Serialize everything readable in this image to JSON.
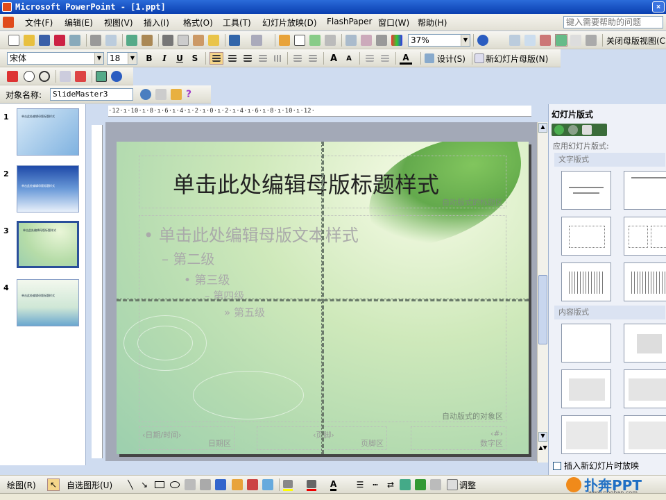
{
  "window": {
    "title": "Microsoft PowerPoint - [1.ppt]",
    "min": "_",
    "max": "□",
    "close": "×"
  },
  "menu": {
    "items": [
      "文件(F)",
      "编辑(E)",
      "视图(V)",
      "插入(I)",
      "格式(O)",
      "工具(T)",
      "幻灯片放映(D)",
      "FlashPaper",
      "窗口(W)",
      "帮助(H)"
    ],
    "help_placeholder": "键入需要帮助的问题"
  },
  "standard_toolbar": {
    "zoom": "37%",
    "close_master_view": "关闭母版视图(C)"
  },
  "formatting_toolbar": {
    "font": "宋体",
    "size": "18",
    "bold": "B",
    "italic": "I",
    "underline": "U",
    "shadow": "S",
    "font_color": "A",
    "design": "设计(S)",
    "new_master": "新幻灯片母版(N)"
  },
  "object_toolbar": {
    "label": "对象名称:",
    "object_name": "SlideMaster3"
  },
  "slides": {
    "numbers": [
      "1",
      "2",
      "3",
      "4"
    ],
    "thumb_title": "单击此处编辑母版标题样式"
  },
  "ruler": {
    "h": "·12·ı·10·ı·8·ı·6·ı·4·ı·2·ı·0·ı·2·ı·4·ı·6·ı·8·ı·10·ı·12·"
  },
  "slide": {
    "title": "单击此处编辑母版标题样式",
    "title_area": "自动版式的标题区",
    "bullets": [
      "单击此处编辑母版文本样式",
      "第二级",
      "第三级",
      "第四级",
      "第五级"
    ],
    "bullet_marks": [
      "•",
      "–",
      "•",
      "–",
      "»"
    ],
    "object_area": "自动版式的对象区",
    "date_ph": "‹日期/时间›",
    "date_area": "日期区",
    "footer_ph": "‹页脚›",
    "footer_area": "页脚区",
    "num_ph": "‹#›",
    "num_area": "数字区"
  },
  "task_pane": {
    "title": "幻灯片版式",
    "apply": "应用幻灯片版式:",
    "text_layouts": "文字版式",
    "content_layouts": "内容版式",
    "show_on_insert": "插入新幻灯片时放映"
  },
  "drawing_toolbar": {
    "draw": "绘图(R)",
    "autoshapes": "自选图形(U)",
    "adjust": "调整"
  },
  "watermark": {
    "brand": "扑奔PPT",
    "url": "www.pooban.com"
  },
  "colors": {
    "titlebar": "#0a3fb0",
    "accent": "#2a4f9a"
  }
}
